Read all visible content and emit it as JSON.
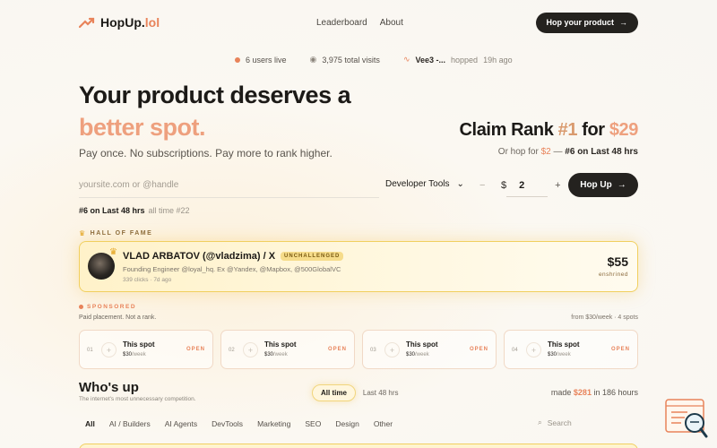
{
  "nav": {
    "brand_main": "HopUp.",
    "brand_accent": "lol",
    "links": [
      "Leaderboard",
      "About"
    ],
    "cta": "Hop your product"
  },
  "stats": {
    "users_live": "6 users live",
    "total_visits": "3,975 total visits",
    "latest_user": "Vee3 -...",
    "latest_action": "hopped",
    "latest_time": "19h ago"
  },
  "hero": {
    "title_line1": "Your product deserves a",
    "title_line2": "better spot.",
    "subtitle": "Pay once. No subscriptions. Pay more to rank higher."
  },
  "claim": {
    "prefix": "Claim Rank ",
    "rank": "#1",
    "mid": " for ",
    "price": "$29",
    "sub_prefix": "Or hop for ",
    "sub_price": "$2",
    "sub_dash": " — ",
    "sub_rank": "#6 on Last 48 hrs"
  },
  "form": {
    "url_placeholder": "yoursite.com or @handle",
    "category": "Developer Tools",
    "minus": "−",
    "currency": "$",
    "amount": "2",
    "plus": "+",
    "submit": "Hop Up"
  },
  "rank_note": {
    "main": "#6 on Last 48 hrs",
    "sub": "all time #22"
  },
  "hall_of_fame": {
    "label": "HALL OF FAME",
    "name": "VLAD ARBATOV (@vladzima) / X",
    "badge": "UNCHALLENGED",
    "bio": "Founding Engineer @loyal_hq. Ex @Yandex, @Mapbox, @500GlobalVC",
    "meta": "339 clicks · 7d ago",
    "price": "$55",
    "status": "enshrined"
  },
  "sponsored": {
    "label": "SPONSORED",
    "note": "Paid placement. Not a rank.",
    "price_note": "from $30/week · 4 spots",
    "spots": [
      {
        "idx": "01",
        "title": "This spot",
        "price": "$30",
        "unit": "/week",
        "status": "OPEN"
      },
      {
        "idx": "02",
        "title": "This spot",
        "price": "$30",
        "unit": "/week",
        "status": "OPEN"
      },
      {
        "idx": "03",
        "title": "This spot",
        "price": "$30",
        "unit": "/week",
        "status": "OPEN"
      },
      {
        "idx": "04",
        "title": "This spot",
        "price": "$30",
        "unit": "/week",
        "status": "OPEN"
      }
    ]
  },
  "who": {
    "title": "Who's up",
    "subtitle": "The internet's most unnecessary competition.",
    "toggle_on": "All time",
    "toggle_off": "Last 48 hrs",
    "made_prefix": "made ",
    "made_amount": "$281",
    "made_suffix": " in 186 hours"
  },
  "filters": [
    "All",
    "AI / Builders",
    "AI Agents",
    "DevTools",
    "Marketing",
    "SEO",
    "Design",
    "Other"
  ],
  "search_placeholder": "Search",
  "colors": {
    "accent": "#e8835a",
    "dark": "#24221f",
    "gold": "#f1cf5f"
  }
}
